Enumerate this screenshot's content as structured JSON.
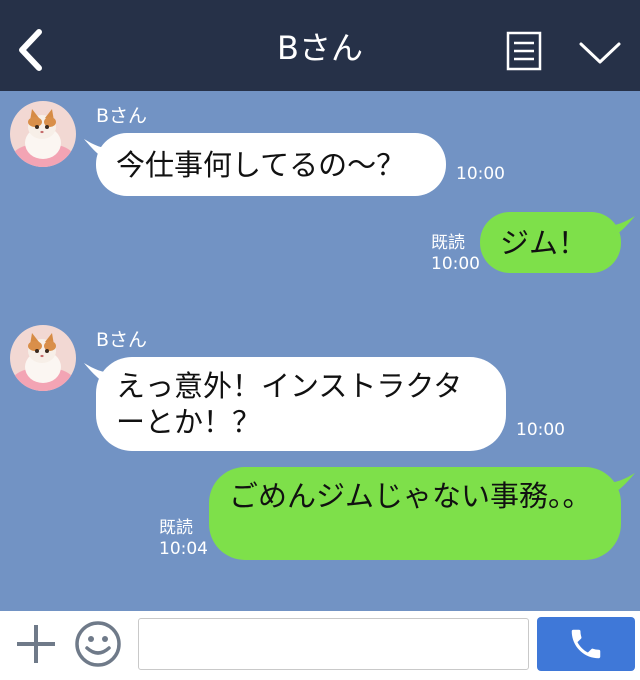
{
  "header": {
    "title": "Bさん",
    "back_icon": "chevron-left-icon",
    "menu_icon": "menu-icon",
    "dropdown_icon": "chevron-down-icon"
  },
  "colors": {
    "header_bg": "#263148",
    "chat_bg": "#7293c4",
    "outgoing_bubble": "#7ee04a",
    "incoming_bubble": "#ffffff",
    "call_button": "#3f78d8"
  },
  "messages": [
    {
      "direction": "in",
      "sender": "Bさん",
      "text": "今仕事何してるの〜？",
      "time": "10:00"
    },
    {
      "direction": "out",
      "text": "ジム！",
      "read": "既読",
      "time": "10:00"
    },
    {
      "direction": "in",
      "sender": "Bさん",
      "text": "えっ意外！インストラクターとか！？",
      "time": "10:00"
    },
    {
      "direction": "out",
      "text": "ごめんジムじゃない事務。。",
      "read": "既読",
      "time": "10:04"
    }
  ],
  "input_bar": {
    "plus_icon": "plus-icon",
    "emoji_icon": "smiley-icon",
    "call_icon": "phone-icon",
    "text_value": ""
  }
}
